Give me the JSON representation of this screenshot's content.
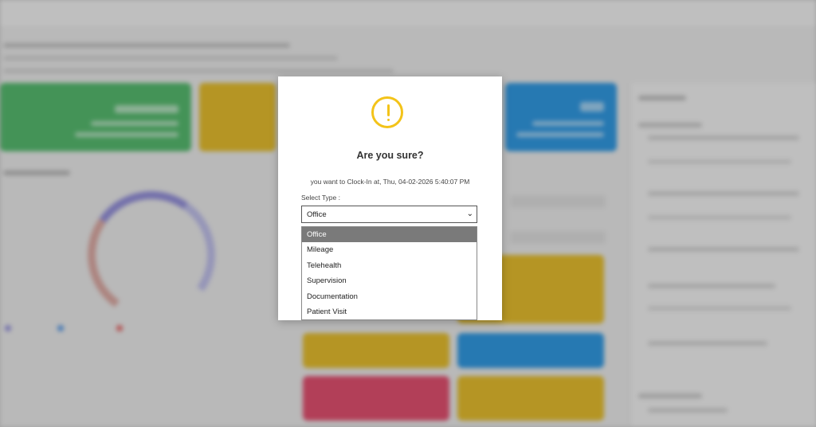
{
  "modal": {
    "icon": "exclamation-circle-icon",
    "title": "Are you sure?",
    "message": "you want to Clock-In at, Thu, 04-02-2026 5:40:07 PM",
    "select_label": "Select Type :",
    "select_value": "Office",
    "options": [
      "Office",
      "Mileage",
      "Telehealth",
      "Supervision",
      "Documentation",
      "Patient Visit"
    ],
    "selected_index": 0
  },
  "colors": {
    "warning": "#f3c319",
    "selected_option_bg": "#7a7a7a",
    "card_green": "#47b562",
    "card_yellow": "#e3b81b",
    "card_blue": "#1e90e0",
    "card_red": "#e04063"
  }
}
